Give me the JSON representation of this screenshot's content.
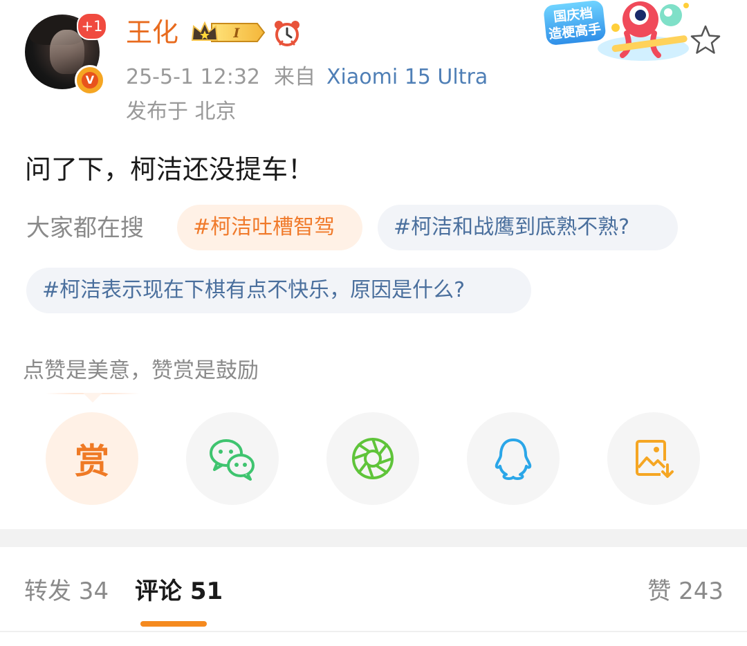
{
  "author": {
    "name": "王化",
    "new_badge": "+1",
    "verified_mark": "V",
    "level_badge": "I"
  },
  "meta": {
    "time": "25-5-1 12:32",
    "from_label": "来自",
    "device": "Xiaomi 15 Ultra",
    "location": "发布于 北京"
  },
  "promo": {
    "line1": "国庆档",
    "line2": "造梗高手"
  },
  "post": {
    "text": "问了下，柯洁还没提车！"
  },
  "search": {
    "label": "大家都在搜",
    "tags": [
      "#柯洁吐槽智驾",
      "#柯洁和战鹰到底熟不熟?",
      "#柯洁表示现在下棋有点不快乐，原因是什么?"
    ]
  },
  "reward": {
    "tip": "点赞是美意，赞赏是鼓励",
    "button_char": "赏"
  },
  "share_icons": [
    "reward-icon",
    "wechat-icon",
    "moments-icon",
    "qq-icon",
    "save-image-icon"
  ],
  "tabs": {
    "repost": "转发 34",
    "comment": "评论 51",
    "like": "赞 243"
  },
  "colors": {
    "accent": "#f58a1f",
    "name": "#e86b1e",
    "link": "#4f7fb6",
    "wechat": "#3fc46f",
    "moments": "#5fc43a",
    "qq": "#2aa6e8"
  }
}
